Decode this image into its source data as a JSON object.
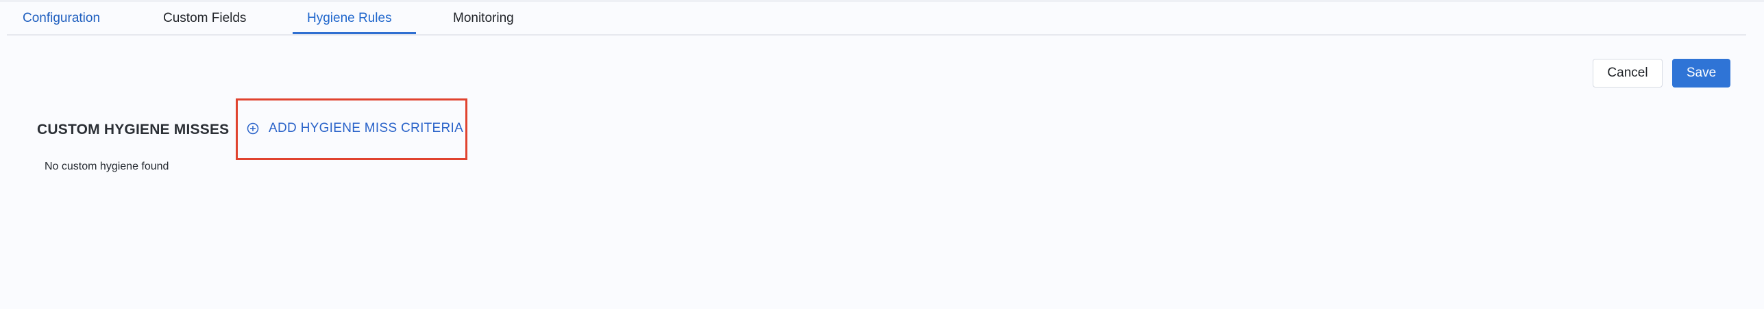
{
  "tabs": [
    {
      "label": "Configuration"
    },
    {
      "label": "Custom Fields"
    },
    {
      "label": "Hygiene Rules",
      "active": true
    },
    {
      "label": "Monitoring"
    }
  ],
  "actions": {
    "cancel_label": "Cancel",
    "save_label": "Save"
  },
  "section": {
    "title": "CUSTOM HYGIENE MISSES",
    "add_label": "ADD HYGIENE MISS CRITERIA",
    "empty_text": "No custom hygiene found"
  },
  "icons": {
    "add": "plus-circle-icon"
  },
  "colors": {
    "accent": "#2f74d6",
    "active_tab": "#1f66cc",
    "highlight_box": "#e0432f",
    "background": "#fafbfe"
  }
}
